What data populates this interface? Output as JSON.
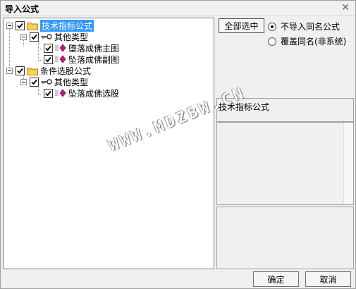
{
  "window": {
    "title": "导入公式"
  },
  "tree": {
    "root1": {
      "label": "技术指标公式",
      "checked": true
    },
    "root1_child": {
      "label": "其他类型",
      "checked": true
    },
    "root1_leaf1": {
      "label": "堕落成佛主图",
      "checked": true
    },
    "root1_leaf2": {
      "label": "坠落成佛副图",
      "checked": true
    },
    "root2": {
      "label": "条件选股公式",
      "checked": true
    },
    "root2_child": {
      "label": "其他类型",
      "checked": true
    },
    "root2_leaf1": {
      "label": "坠落成佛选股",
      "checked": true
    }
  },
  "options": {
    "select_all_label": "全部选中",
    "radio_no_import": "不导入同名公式",
    "radio_overwrite": "覆盖同名(非系统)",
    "selected_radio": "no_import"
  },
  "info": {
    "name_text": "技术指标公式",
    "description_text": ""
  },
  "buttons": {
    "ok_label": "确定",
    "cancel_label": "取消"
  },
  "watermark": {
    "text": "WWW.MDZBW.CN"
  },
  "colors": {
    "selection": "#3399ff",
    "folder": "#f5d35a",
    "formula_icon": "#c0188c"
  },
  "icons": {
    "folder": "folder-icon",
    "category": "key-icon",
    "formula": "formula-icon",
    "check": "check-icon"
  }
}
